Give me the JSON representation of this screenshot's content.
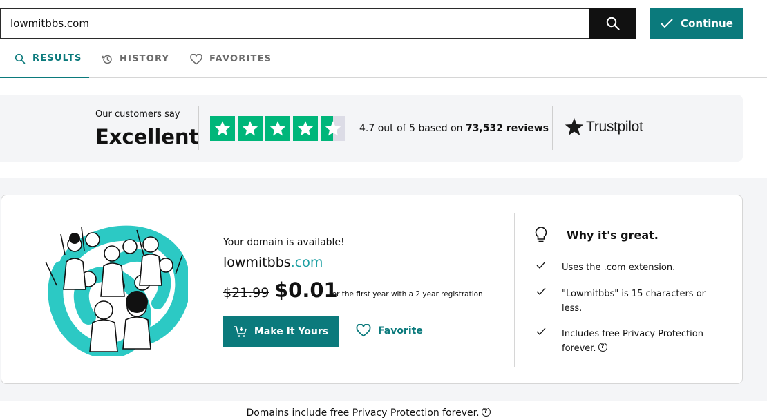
{
  "search": {
    "value": "lowmitbbs.com",
    "placeholder": "",
    "button_icon": "search-icon",
    "continue_label": "Continue"
  },
  "tabs": [
    {
      "label": "RESULTS",
      "icon": "search-icon",
      "active": true
    },
    {
      "label": "HISTORY",
      "icon": "history-icon",
      "active": false
    },
    {
      "label": "FAVORITES",
      "icon": "heart-icon",
      "active": false
    }
  ],
  "trustpilot": {
    "customers_say": "Our customers say",
    "rating_word": "Excellent",
    "rating": 4.7,
    "rating_text": "4.7 out of 5 based on",
    "review_count": "73,532 reviews",
    "brand": "Trustpilot",
    "star_color": "#00b67a"
  },
  "result": {
    "available_text": "Your domain is available!",
    "domain_sld": "lowmitbbs",
    "domain_tld": ".com",
    "old_price": "$21.99",
    "new_price": "$0.01",
    "price_note": "for the first year with a 2 year registration",
    "make_it_yours_label": "Make It Yours",
    "favorite_label": "Favorite"
  },
  "why": {
    "title": "Why it's great.",
    "items": [
      "Uses the .com extension.",
      "\"Lowmitbbs\" is 15 characters or less.",
      "Includes free Privacy Protection forever."
    ]
  },
  "footer": {
    "privacy_note": "Domains include free Privacy Protection forever."
  },
  "colors": {
    "accent": "#0b7a7c",
    "tld": "#1fa0a3",
    "dark": "#111111",
    "band": "#f4f5f7"
  }
}
